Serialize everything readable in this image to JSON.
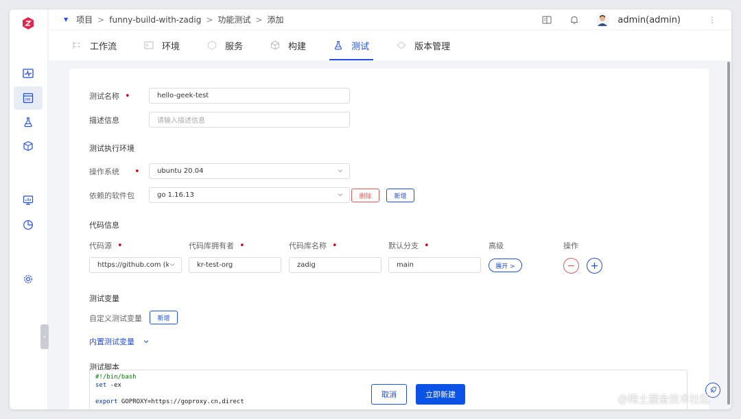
{
  "breadcrumb": {
    "items": [
      "项目",
      "funny-build-with-zadig",
      "功能测试",
      "添加"
    ],
    "separator": ">"
  },
  "header": {
    "user": "admin(admin)"
  },
  "tabs": [
    {
      "label": "工作流",
      "icon": "workflow-icon"
    },
    {
      "label": "环境",
      "icon": "environment-icon"
    },
    {
      "label": "服务",
      "icon": "service-icon"
    },
    {
      "label": "构建",
      "icon": "build-icon"
    },
    {
      "label": "测试",
      "icon": "flask-icon",
      "active": true
    },
    {
      "label": "版本管理",
      "icon": "version-icon"
    }
  ],
  "form": {
    "test_name_label": "测试名称",
    "test_name_value": "hello-geek-test",
    "desc_label": "描述信息",
    "desc_placeholder": "请输入描述信息",
    "env_section": "测试执行环境",
    "os_label": "操作系统",
    "os_value": "ubuntu 20.04",
    "deps_label": "依赖的软件包",
    "deps_value": "go 1.16.13",
    "delete_label": "删除",
    "add_label": "新增",
    "repo_section": "代码信息",
    "repo_cols": [
      "代码源",
      "代码库拥有者",
      "代码库名称",
      "默认分支",
      "高级",
      "操作"
    ],
    "repo_source": "https://github.com (kr-t",
    "repo_owner": "kr-test-org",
    "repo_name": "zadig",
    "repo_branch": "main",
    "expand_label": "展开 >",
    "vars_section": "测试变量",
    "custom_vars_label": "自定义测试变量",
    "custom_vars_add": "新增",
    "builtin_vars_label": "内置测试变量",
    "script_section": "测试脚本",
    "script_lines": [
      "#!/bin/bash",
      "set -ex",
      "",
      "export GOPROXY=https://goproxy.cn,direct"
    ]
  },
  "actions": {
    "cancel": "取消",
    "create": "立即新建"
  },
  "watermark": "@稀土掘金技术社区",
  "colors": {
    "accent": "#1f4ee6",
    "required": "#d0021b",
    "danger": "#e05a5a",
    "logo": "#e0284c"
  }
}
